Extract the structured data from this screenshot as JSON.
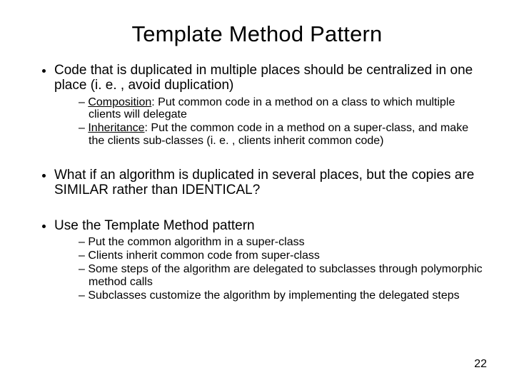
{
  "title": "Template Method Pattern",
  "page_number": "22",
  "bullets": {
    "b1": "Code that is duplicated in multiple places should be centralized in one place (i. e. , avoid duplication)",
    "b1_sub": {
      "s1_label": "Composition",
      "s1_rest": ": Put common code in a method on a class to which multiple clients will delegate",
      "s2_label": "Inheritance",
      "s2_rest": ": Put the common code in a method on a super-class, and make the clients sub-classes (i. e. , clients inherit common code)"
    },
    "b2": "What if an algorithm is duplicated in several places, but the copies are SIMILAR rather than IDENTICAL?",
    "b3": "Use the Template Method pattern",
    "b3_sub": {
      "s1": "Put the common algorithm in a super-class",
      "s2": "Clients inherit common code from super-class",
      "s3": "Some steps of the algorithm are delegated to subclasses through polymorphic method calls",
      "s4": "Subclasses customize the algorithm by implementing the delegated steps"
    }
  }
}
